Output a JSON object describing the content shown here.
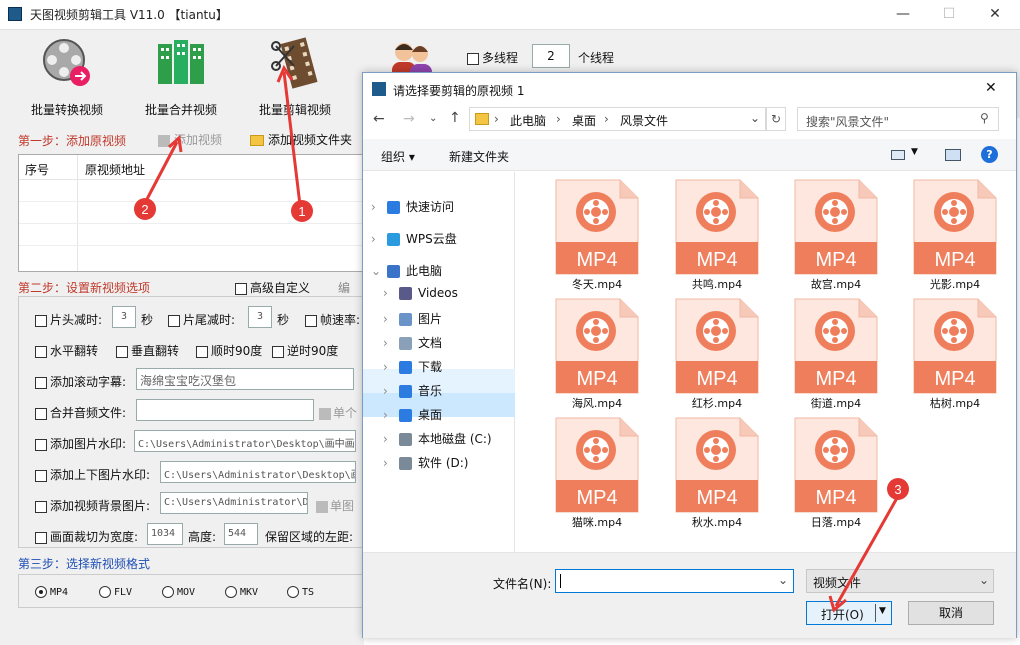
{
  "app": {
    "title": "天图视频剪辑工具 V11.0  【tiantu】",
    "min": "—",
    "max": "☐",
    "close": "✕"
  },
  "toolbar": {
    "convert": "批量转换视频",
    "merge": "批量合并视频",
    "clip": "批量剪辑视频",
    "multithread_label": "多线程",
    "threads_value": "2",
    "threads_unit": "个线程"
  },
  "step1": {
    "title": "第一步：添加原视频",
    "add_video": "添加视频",
    "add_folder": "添加视频文件夹",
    "col_index": "序号",
    "col_path": "原视频地址"
  },
  "step2": {
    "title": "第二步：设置新视频选项",
    "advanced": "高级自定义",
    "edit": "编",
    "head_cut": "片头减时:",
    "head_val": "3",
    "sec1": "秒",
    "tail_cut": "片尾减时:",
    "tail_val": "3",
    "sec2": "秒",
    "framerate": "帧速率:",
    "hflip": "水平翻转",
    "vflip": "垂直翻转",
    "rot_cw": "顺时90度",
    "rot_ccw": "逆时90度",
    "scroll_caption": "添加滚动字幕:",
    "scroll_text": "海绵宝宝吃汉堡包",
    "merge_audio": "合并音频文件:",
    "single": "单个",
    "img_watermark": "添加图片水印:",
    "img_watermark_path": "C:\\Users\\Administrator\\Desktop\\画中画",
    "tb_watermark": "添加上下图片水印:",
    "tb_watermark_path": "C:\\Users\\Administrator\\Desktop\\画",
    "bg_image": "添加视频背景图片:",
    "bg_image_path": "C:\\Users\\Administrator\\D",
    "single_img": "单图",
    "crop": "画面裁切为宽度:",
    "crop_w": "1034",
    "height_label": "高度:",
    "crop_h": "544",
    "keep_left": "保留区域的左距:"
  },
  "step3": {
    "title": "第三步：选择新视频格式",
    "formats": [
      "MP4",
      "FLV",
      "MOV",
      "MKV",
      "TS"
    ],
    "selected": "MP4"
  },
  "dialog": {
    "title": "请选择要剪辑的原视频 1",
    "close": "✕",
    "breadcrumb": [
      "此电脑",
      "桌面",
      "风景文件"
    ],
    "search_placeholder": "搜索\"风景文件\"",
    "organize": "组织 ▾",
    "new_folder": "新建文件夹",
    "help": "?",
    "tree": [
      {
        "label": "快速访问",
        "icon": "star-icon"
      },
      {
        "label": "WPS云盘",
        "icon": "cloud-icon"
      },
      {
        "label": "此电脑",
        "icon": "computer-icon"
      },
      {
        "label": "Videos",
        "icon": "video-folder-icon"
      },
      {
        "label": "图片",
        "icon": "pictures-icon"
      },
      {
        "label": "文档",
        "icon": "documents-icon"
      },
      {
        "label": "下载",
        "icon": "download-icon"
      },
      {
        "label": "音乐",
        "icon": "music-icon"
      },
      {
        "label": "桌面",
        "icon": "desktop-icon"
      },
      {
        "label": "本地磁盘 (C:)",
        "icon": "drive-icon"
      },
      {
        "label": "软件 (D:)",
        "icon": "drive-icon"
      }
    ],
    "files": [
      "冬天.mp4",
      "共鸣.mp4",
      "故宫.mp4",
      "光影.mp4",
      "海风.mp4",
      "红杉.mp4",
      "街道.mp4",
      "枯树.mp4",
      "猫咪.mp4",
      "秋水.mp4",
      "日落.mp4"
    ],
    "file_badge": "MP4",
    "filename_label": "文件名(N):",
    "filename_value": "",
    "filetype": "视频文件",
    "open": "打开(O)",
    "cancel": "取消"
  },
  "annotations": [
    "1",
    "2",
    "3"
  ],
  "colors": {
    "step_red": "#c0392b",
    "step_blue": "#1f4fb5",
    "mp4_orange": "#ef7e5c",
    "annotation_red": "#e53935",
    "selection": "#cce8ff"
  }
}
